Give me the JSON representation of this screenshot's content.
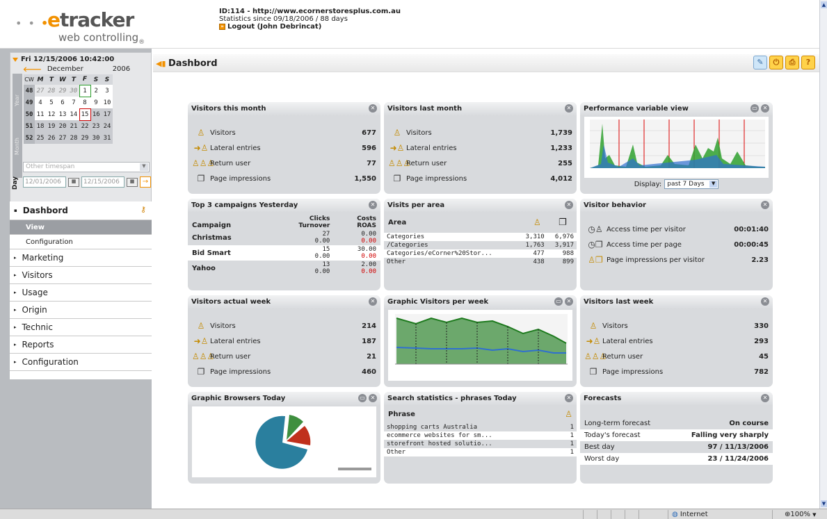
{
  "header": {
    "logo_e": "e",
    "logo_word": "tracker",
    "logo_sub": "web controlling",
    "id_line": "ID:114 - http://www.ecornerstoresplus.com.au",
    "since_line": "Statistics since 09/18/2006 / 88 days",
    "logout": "Logout (John Debrincat)"
  },
  "calendar": {
    "datetime": "Fri 12/15/2006 10:42:00",
    "month": "December",
    "year": "2006",
    "side_tabs": [
      "Year",
      "Month"
    ],
    "day_label": "Day",
    "headers": [
      "CW",
      "M",
      "T",
      "W",
      "T",
      "F",
      "S",
      "S"
    ],
    "weeks": [
      [
        "48",
        "27",
        "28",
        "29",
        "30",
        "1",
        "2",
        "3"
      ],
      [
        "49",
        "4",
        "5",
        "6",
        "7",
        "8",
        "9",
        "10"
      ],
      [
        "50",
        "11",
        "12",
        "13",
        "14",
        "15",
        "16",
        "17"
      ],
      [
        "51",
        "18",
        "19",
        "20",
        "21",
        "22",
        "23",
        "24"
      ],
      [
        "52",
        "25",
        "26",
        "27",
        "28",
        "29",
        "30",
        "31"
      ]
    ],
    "timespan_placeholder": "Other timespan",
    "date_from": "12/01/2006",
    "date_to": "12/15/2006"
  },
  "nav": {
    "dashboard": "Dashbord",
    "sub_items": [
      "View",
      "Configuration"
    ],
    "items": [
      "Marketing",
      "Visitors",
      "Usage",
      "Origin",
      "Technic",
      "Reports",
      "Configuration"
    ]
  },
  "page": {
    "title": "Dashbord"
  },
  "panels": {
    "visitors_month": {
      "title": "Visitors this month",
      "rows": [
        {
          "label": "Visitors",
          "value": "677"
        },
        {
          "label": "Lateral entries",
          "value": "596"
        },
        {
          "label": "Return user",
          "value": "77"
        },
        {
          "label": "Page impressions",
          "value": "1,550"
        }
      ]
    },
    "visitors_last_month": {
      "title": "Visitors last month",
      "rows": [
        {
          "label": "Visitors",
          "value": "1,739"
        },
        {
          "label": "Lateral entries",
          "value": "1,233"
        },
        {
          "label": "Return user",
          "value": "255"
        },
        {
          "label": "Page impressions",
          "value": "4,012"
        }
      ]
    },
    "performance": {
      "title": "Performance variable view",
      "display_label": "Display:",
      "display_value": "past 7 Days"
    },
    "campaigns": {
      "title": "Top 3 campaigns Yesterday",
      "col_campaign": "Campaign",
      "col_clicks": "Clicks",
      "col_turnover": "Turnover",
      "col_costs": "Costs",
      "col_roas": "ROAS",
      "rows": [
        {
          "name": "Christmas",
          "clicks": "27",
          "turnover": "0.00",
          "costs": "0.00",
          "roas": "0.00"
        },
        {
          "name": "Bid Smart",
          "clicks": "15",
          "turnover": "0.00",
          "costs": "30.00",
          "roas": "0.00"
        },
        {
          "name": "Yahoo",
          "clicks": "13",
          "turnover": "0.00",
          "costs": "2.00",
          "roas": "0.00"
        }
      ]
    },
    "visits_area": {
      "title": "Visits per area",
      "col_area": "Area",
      "rows": [
        {
          "area": "Categories",
          "a": "3,310",
          "b": "6,976"
        },
        {
          "area": "/Categories",
          "a": "1,763",
          "b": "3,917"
        },
        {
          "area": "Categories/eCorner%20Stor...",
          "a": "477",
          "b": "988"
        },
        {
          "area": "Other",
          "a": "438",
          "b": "899"
        }
      ]
    },
    "visitor_behavior": {
      "title": "Visitor behavior",
      "rows": [
        {
          "label": "Access time per visitor",
          "value": "00:01:40"
        },
        {
          "label": "Access time per page",
          "value": "00:00:45"
        },
        {
          "label": "Page impressions per visitor",
          "value": "2.23"
        }
      ]
    },
    "visitors_week": {
      "title": "Visitors actual week",
      "rows": [
        {
          "label": "Visitors",
          "value": "214"
        },
        {
          "label": "Lateral entries",
          "value": "187"
        },
        {
          "label": "Return user",
          "value": "21"
        },
        {
          "label": "Page impressions",
          "value": "460"
        }
      ]
    },
    "graphic_week": {
      "title": "Graphic Visitors per week"
    },
    "visitors_last_week": {
      "title": "Visitors last week",
      "rows": [
        {
          "label": "Visitors",
          "value": "330"
        },
        {
          "label": "Lateral entries",
          "value": "293"
        },
        {
          "label": "Return user",
          "value": "45"
        },
        {
          "label": "Page impressions",
          "value": "782"
        }
      ]
    },
    "browsers": {
      "title": "Graphic Browsers Today"
    },
    "search": {
      "title": "Search statistics - phrases Today",
      "col_phrase": "Phrase",
      "rows": [
        {
          "phrase": "shopping carts Australia",
          "value": "1"
        },
        {
          "phrase": "ecommerce websites for sm...",
          "value": "1"
        },
        {
          "phrase": "storefront hosted solutio...",
          "value": "1"
        },
        {
          "phrase": "Other",
          "value": "1"
        }
      ]
    },
    "forecasts": {
      "title": "Forecasts",
      "rows": [
        {
          "label": "Long-term forecast",
          "value": "On course"
        },
        {
          "label": "Today's forecast",
          "value": "Falling very sharply"
        },
        {
          "label": "Best day",
          "value": "97 / 11/13/2006"
        },
        {
          "label": "Worst day",
          "value": "23 / 11/24/2006"
        }
      ]
    }
  },
  "statusbar": {
    "zone": "Internet",
    "zoom": "100%"
  },
  "icons": [
    "person-icon",
    "arrow-person-icon",
    "group-icon",
    "pages-icon",
    "clock-icon",
    "close-icon",
    "minimize-icon",
    "key-icon",
    "help-icon",
    "print-icon",
    "power-icon",
    "wand-icon",
    "globe-icon"
  ],
  "colors": {
    "accent": "#f29100",
    "panel": "#d8dadd",
    "chart_green": "#2ea02e",
    "chart_blue": "#2f6fd0",
    "red_value": "#d00000",
    "pie_blue": "#2a7f9e",
    "pie_red": "#c0301c",
    "pie_green": "#3f8f3f"
  }
}
